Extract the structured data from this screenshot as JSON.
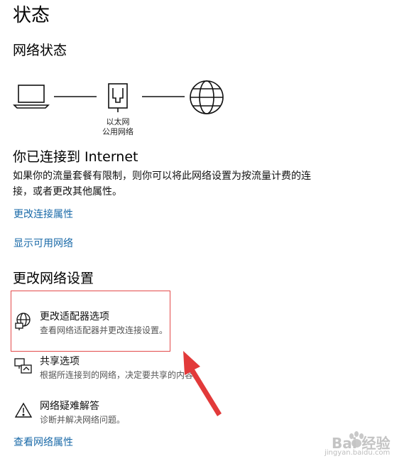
{
  "page": {
    "title": "状态"
  },
  "network_status": {
    "heading": "网络状态",
    "adapter_label_1": "以太网",
    "adapter_label_2": "公用网络"
  },
  "connection": {
    "title": "你已连接到 Internet",
    "description": "如果你的流量套餐有限制，则你可以将此网络设置为按流量计费的连接，或者更改其他属性。"
  },
  "links": {
    "change_props": "更改连接属性",
    "show_available": "显示可用网络",
    "view_props": "查看网络属性"
  },
  "change_settings": {
    "heading": "更改网络设置",
    "items": [
      {
        "title": "更改适配器选项",
        "subtitle": "查看网络适配器并更改连接设置。",
        "icon": "adapter-globe-icon"
      },
      {
        "title": "共享选项",
        "subtitle": "根据所连接到的网络，决定要共享的内容。",
        "icon": "sharing-icon"
      },
      {
        "title": "网络疑难解答",
        "subtitle": "诊断并解决网络问题。",
        "icon": "warning-icon"
      }
    ]
  },
  "annotation": {
    "highlight_color": "#e34b4b",
    "arrow_color": "#e23a3a"
  },
  "watermark": {
    "brand": "Bai 经验",
    "url": "jingyan.baidu.com"
  },
  "colors": {
    "link": "#1a6aa8",
    "text": "#000000"
  }
}
